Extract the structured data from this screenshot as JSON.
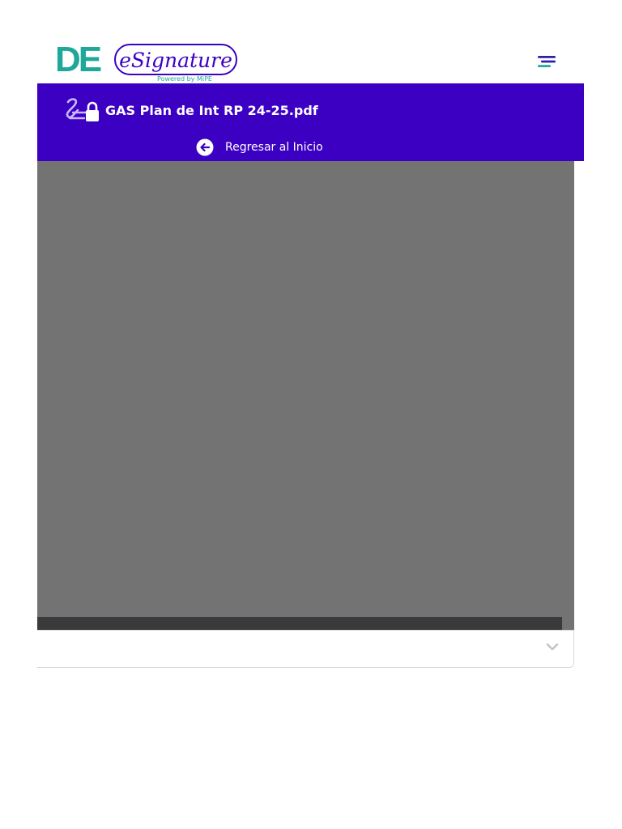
{
  "colors": {
    "brand_teal": "#1fa89a",
    "brand_purple": "#3c00c3",
    "viewer_gray": "#737373",
    "toolbar_dark": "#3a3a3c"
  },
  "header": {
    "logo": {
      "mark": "DE",
      "wordmark": "eSignature",
      "tagline": "Powered by MiPE"
    },
    "menu_icon": "hamburger-menu-icon"
  },
  "document": {
    "icon": "signature-lock-icon",
    "title": "GAS Plan de Int RP 24-25.pdf",
    "back_icon": "arrow-left-circle-icon",
    "back_label": "Regresar al Inicio"
  },
  "panel": {
    "toggle_icon": "chevron-down-icon"
  }
}
